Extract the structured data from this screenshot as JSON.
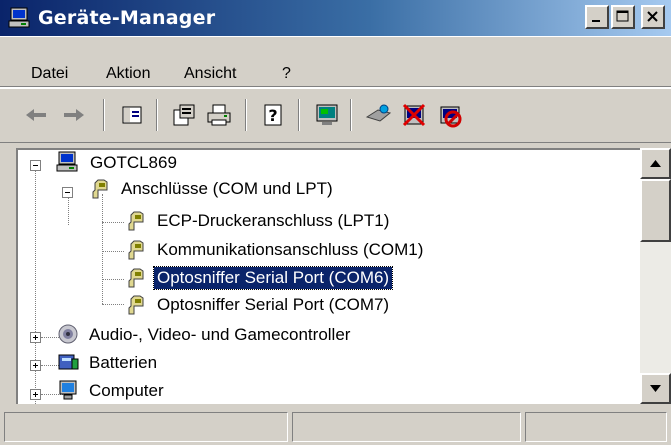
{
  "window": {
    "title": "Geräte-Manager",
    "caption_buttons": [
      "minimize",
      "maximize",
      "close"
    ]
  },
  "menu": {
    "items": [
      {
        "label": "Datei"
      },
      {
        "label": "Aktion"
      },
      {
        "label": "Ansicht"
      },
      {
        "label": "?"
      }
    ]
  },
  "toolbar": {
    "buttons": [
      "back-arrow-icon",
      "forward-arrow-icon",
      "show-hide-tree-icon",
      "properties-icon",
      "print-icon",
      "help-icon",
      "monitor-icon",
      "scan-hardware-icon",
      "uninstall-icon",
      "disable-icon"
    ]
  },
  "tree": {
    "root": "GOTCL869",
    "category_ports": "Anschlüsse (COM und LPT)",
    "ports": [
      "ECP-Druckeranschluss (LPT1)",
      "Kommunikationsanschluss (COM1)",
      "Optosniffer Serial Port (COM6)",
      "Optosniffer Serial Port (COM7)"
    ],
    "selected": "Optosniffer Serial Port (COM6)",
    "category_audio": "Audio-, Video- und Gamecontroller",
    "category_batteries": "Batterien",
    "category_computer": "Computer"
  },
  "colors": {
    "titlebar_start": "#0a246a",
    "titlebar_end": "#a6caf0",
    "selection": "#0a246a",
    "face": "#d4d0c8"
  }
}
